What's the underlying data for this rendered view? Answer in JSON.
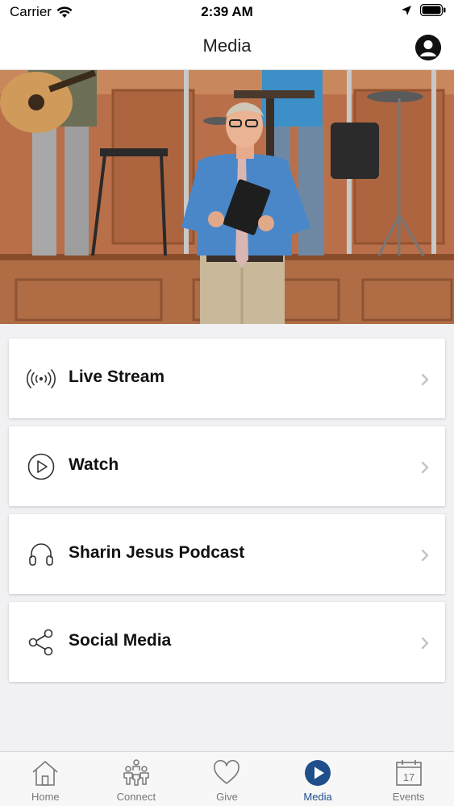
{
  "status_bar": {
    "carrier": "Carrier",
    "time": "2:39 AM"
  },
  "nav": {
    "title": "Media"
  },
  "menu": {
    "items": [
      {
        "label": "Live Stream",
        "icon": "broadcast-icon"
      },
      {
        "label": "Watch",
        "icon": "play-circle-icon"
      },
      {
        "label": "Sharin Jesus Podcast",
        "icon": "headphones-icon"
      },
      {
        "label": "Social Media",
        "icon": "share-icon"
      }
    ]
  },
  "tabs": [
    {
      "label": "Home",
      "icon": "home-icon",
      "active": false
    },
    {
      "label": "Connect",
      "icon": "people-icon",
      "active": false
    },
    {
      "label": "Give",
      "icon": "heart-icon",
      "active": false
    },
    {
      "label": "Media",
      "icon": "play-circle-filled-icon",
      "active": true
    },
    {
      "label": "Events",
      "icon": "calendar-icon",
      "active": false
    }
  ],
  "calendar_day": "17",
  "colors": {
    "accent": "#1f4f8a",
    "tab_inactive": "#777777"
  }
}
